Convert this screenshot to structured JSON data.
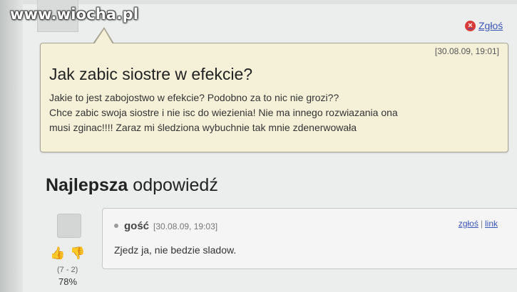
{
  "watermark": "www.wiocha.pl",
  "report_top": "Zgłoś",
  "question": {
    "date": "[30.08.09, 19:01]",
    "title": "Jak zabic siostre w efekcie?",
    "line1": "Jakie to jest zabojostwo w efekcie? Podobno za to nic nie grozi??",
    "line2": "Chce zabic swoja siostre i nie isc do wiezienia! Nie ma innego rozwiazania ona",
    "line3": "musi zginac!!!! Zaraz mi śledziona wybuchnie tak mnie zdenerwowała"
  },
  "best_answer": {
    "heading_bold": "Najlepsza",
    "heading_rest": "odpowiedź",
    "user": "gość",
    "date": "[30.08.09, 19:03]",
    "report_label": "zgłoś",
    "separator": "|",
    "link_label": "link",
    "text": "Zjedz ja, nie bedzie sladow.",
    "votes": "(7 - 2)",
    "percent": "78%"
  },
  "icons": {
    "close": "x-circle-icon",
    "thumb_up": "thumb-up-icon",
    "thumb_down": "thumb-down-icon"
  },
  "colors": {
    "question_bg": "#f5f1d9",
    "link": "#3a55b6",
    "report_icon": "#d83a3a"
  }
}
